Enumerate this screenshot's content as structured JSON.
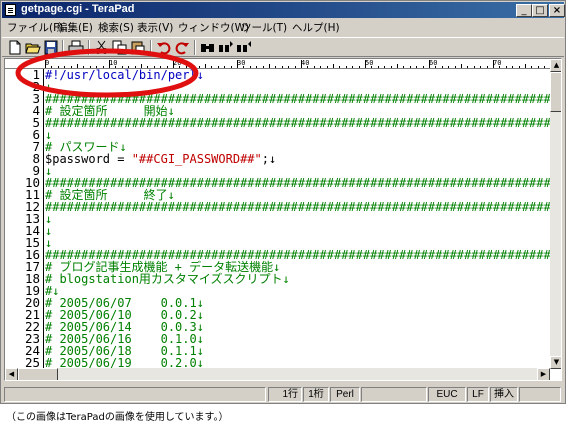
{
  "window": {
    "title": "getpage.cgi - TeraPad"
  },
  "window_buttons": {
    "minimize": "_",
    "maximize": "□",
    "close": "×"
  },
  "menu": [
    "ファイル(F)",
    "編集(E)",
    "検索(S)",
    "表示(V)",
    "ウィンドウ(W)",
    "ツール(T)",
    "ヘルプ(H)"
  ],
  "ruler": {
    "labels": [
      "0",
      "10",
      "20",
      "30",
      "40",
      "50",
      "60",
      "70"
    ]
  },
  "editor": {
    "line_numbers": [
      "1",
      "2",
      "3",
      "4",
      "5",
      "6",
      "7",
      "8",
      "9",
      "10",
      "11",
      "12",
      "13",
      "14",
      "15",
      "16",
      "17",
      "18",
      "19",
      "20",
      "21",
      "22",
      "23",
      "24",
      "25"
    ],
    "lines": [
      "#!/usr/local/bin/perl↓",
      "↓",
      "##########################################################################",
      "# 設定箇所     開始↓",
      "##########################################################################",
      "↓",
      "# パスワード↓",
      "$password = \"##CGI_PASSWORD##\";↓",
      "↓",
      "##########################################################################",
      "# 設定箇所     終了↓",
      "##########################################################################",
      "↓",
      "↓",
      "↓",
      "##########################################################################",
      "# ブログ記事生成機能 + データ転送機能↓",
      "# blogstation用カスタマイズスクリプト↓",
      "#↓",
      "# 2005/06/07    0.0.1↓",
      "# 2005/06/10    0.0.2↓",
      "# 2005/06/14    0.0.3↓",
      "# 2005/06/16    0.1.0↓",
      "# 2005/06/18    0.1.1↓",
      "# 2005/06/19    0.2.0↓"
    ],
    "line8_parts": {
      "var": "$password = ",
      "str": "\"##CGI_PASSWORD##\"",
      "end": ";↓"
    }
  },
  "status": {
    "line": "1行",
    "col": "1桁",
    "mode": "Perl",
    "encoding": "EUC",
    "newline": "LF",
    "insert": "挿入"
  },
  "caption": "（この画像はTeraPadの画像を使用しています。）",
  "icons": [
    "new-file-icon",
    "open-folder-icon",
    "save-icon",
    "print-icon",
    "cut-icon",
    "copy-icon",
    "paste-icon",
    "undo-icon",
    "redo-icon",
    "find-icon",
    "find-next-icon",
    "find-prev-icon"
  ],
  "colors": {
    "titlebar_start": "#0a246a",
    "titlebar_end": "#3a6ea5",
    "comment": "#008000",
    "string": "#c00000",
    "highlight_ellipse": "#e01010"
  }
}
